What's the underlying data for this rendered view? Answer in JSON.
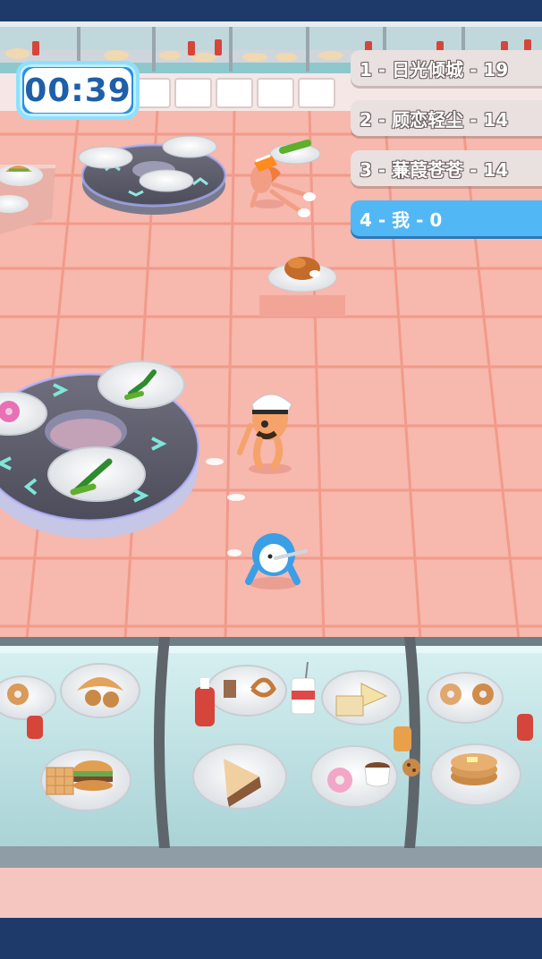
{
  "hud": {
    "timer": "00:39"
  },
  "leaderboard": [
    {
      "rank_text": "1 - 日光倾城 - 19",
      "is_player": false
    },
    {
      "rank_text": "2 - 顾恋轻尘 - 14",
      "is_player": false
    },
    {
      "rank_text": "3 - 蒹葭苍苍 - 14",
      "is_player": false
    },
    {
      "rank_text": "4 - 我 - 0",
      "is_player": true
    }
  ],
  "colors": {
    "floor": "#f7b8ad",
    "floor_line": "#f19a8c",
    "timer_blue": "#2a8fe0",
    "player_row": "#52b8f5",
    "counter_glass": "#bfe4e6",
    "top_bar": "#1d3a6b"
  },
  "scene": {
    "characters": [
      "chef-npc",
      "rival-runner",
      "player-character"
    ],
    "foods": [
      "roast-chicken",
      "leek",
      "donut",
      "croissant",
      "hamburger",
      "waffle",
      "cake-slice",
      "pancakes",
      "sandwich",
      "soda-cup",
      "coffee-cup",
      "pretzel",
      "sausage",
      "taco",
      "ketchup-bottle"
    ]
  }
}
